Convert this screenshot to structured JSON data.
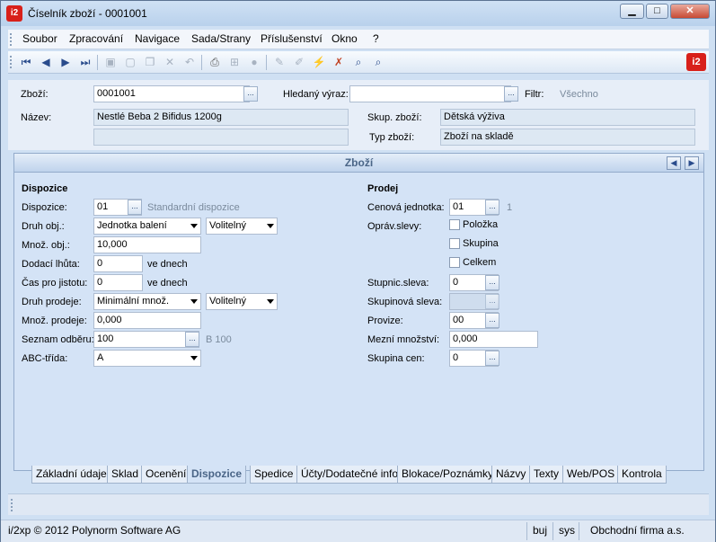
{
  "window": {
    "title": "Číselník zboží - 0001001",
    "app_icon": "i2",
    "minimize": "▁",
    "maximize": "□",
    "close": "✕"
  },
  "menu": [
    "Soubor",
    "Zpracování",
    "Navigace",
    "Sada/Strany",
    "Příslušenství",
    "Okno",
    "?"
  ],
  "toolbar": {
    "icons": [
      "first-icon",
      "prev-icon",
      "next-icon",
      "last-icon",
      "save-icon",
      "new-icon",
      "copy-icon",
      "delete-icon",
      "undo-icon",
      "print-icon",
      "tree-icon",
      "disk-icon",
      "pen-icon",
      "pen2-icon",
      "filter-icon",
      "filter-clear-icon",
      "find-icon",
      "find-next-icon"
    ],
    "logo": "i2"
  },
  "header": {
    "zbozi_label": "Zboží:",
    "zbozi_value": "0001001",
    "hledany_label": "Hledaný výraz:",
    "hledany_value": "",
    "filtr_label": "Filtr:",
    "filtr_value": "Všechno",
    "nazev_label": "Název:",
    "nazev_value": "Nestlé Beba 2 Bifidus 1200g",
    "nazev2_value": "",
    "skup_label": "Skup. zboží:",
    "skup_value": "Dětská výživa",
    "typ_label": "Typ zboží:",
    "typ_value": "Zboží na skladě",
    "ellipsis": "..."
  },
  "panel": {
    "title": "Zboží",
    "prev": "◀",
    "next": "▶",
    "dispozice": {
      "heading": "Dispozice",
      "dispozice_label": "Dispozice:",
      "dispozice_value": "01",
      "dispozice_desc": "Standardní dispozice",
      "druh_obj_label": "Druh obj.:",
      "druh_obj_value": "Jednotka balení",
      "druh_obj_opt": "Volitelný",
      "mnoz_obj_label": "Množ. obj.:",
      "mnoz_obj_value": "10,000",
      "dodaci_label": "Dodací lhůta:",
      "dodaci_value": "0",
      "dodaci_unit": "ve dnech",
      "cas_label": "Čas pro jistotu:",
      "cas_value": "0",
      "cas_unit": "ve dnech",
      "druh_prodeje_label": "Druh prodeje:",
      "druh_prodeje_value": "Minimální množ.",
      "druh_prodeje_opt": "Volitelný",
      "mnoz_prodeje_label": "Množ. prodeje:",
      "mnoz_prodeje_value": "0,000",
      "seznam_label": "Seznam odběru:",
      "seznam_value": "100",
      "seznam_desc": "B 100",
      "abc_label": "ABC-třída:",
      "abc_value": "A"
    },
    "prodej": {
      "heading": "Prodej",
      "cenova_label": "Cenová jednotka:",
      "cenova_value": "01",
      "cenova_desc": "1",
      "oprav_label": "Opráv.slevy:",
      "polozka": "Položka",
      "skupina": "Skupina",
      "celkem": "Celkem",
      "stupnic_label": "Stupnic.sleva:",
      "stupnic_value": "0",
      "skupinova_label": "Skupinová sleva:",
      "skupinova_value": "",
      "provize_label": "Provize:",
      "provize_value": "00",
      "mezni_label": "Mezní množství:",
      "mezni_value": "0,000",
      "skupina_cen_label": "Skupina cen:",
      "skupina_cen_value": "0"
    }
  },
  "tabs": [
    "Základní údaje",
    "Sklad",
    "Ocenění",
    "Dispozice",
    "Spedice",
    "Účty/Dodatečné info",
    "Blokace/Poznámky",
    "Názvy",
    "Texty",
    "Web/POS",
    "Kontrola"
  ],
  "active_tab": "Dispozice",
  "status": {
    "copyright": "i/2xp © 2012 Polynorm Software AG",
    "c1": "buj",
    "c2": "sys",
    "company": "Obchodní firma a.s."
  }
}
